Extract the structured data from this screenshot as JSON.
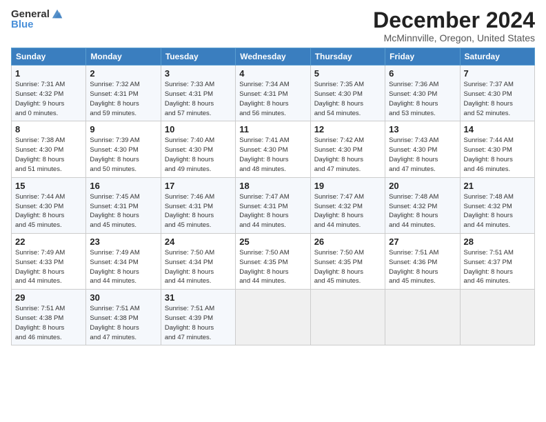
{
  "header": {
    "logo_general": "General",
    "logo_blue": "Blue",
    "title": "December 2024",
    "location": "McMinnville, Oregon, United States"
  },
  "calendar": {
    "days_of_week": [
      "Sunday",
      "Monday",
      "Tuesday",
      "Wednesday",
      "Thursday",
      "Friday",
      "Saturday"
    ],
    "weeks": [
      [
        {
          "day": "1",
          "info": "Sunrise: 7:31 AM\nSunset: 4:32 PM\nDaylight: 9 hours\nand 0 minutes."
        },
        {
          "day": "2",
          "info": "Sunrise: 7:32 AM\nSunset: 4:31 PM\nDaylight: 8 hours\nand 59 minutes."
        },
        {
          "day": "3",
          "info": "Sunrise: 7:33 AM\nSunset: 4:31 PM\nDaylight: 8 hours\nand 57 minutes."
        },
        {
          "day": "4",
          "info": "Sunrise: 7:34 AM\nSunset: 4:31 PM\nDaylight: 8 hours\nand 56 minutes."
        },
        {
          "day": "5",
          "info": "Sunrise: 7:35 AM\nSunset: 4:30 PM\nDaylight: 8 hours\nand 54 minutes."
        },
        {
          "day": "6",
          "info": "Sunrise: 7:36 AM\nSunset: 4:30 PM\nDaylight: 8 hours\nand 53 minutes."
        },
        {
          "day": "7",
          "info": "Sunrise: 7:37 AM\nSunset: 4:30 PM\nDaylight: 8 hours\nand 52 minutes."
        }
      ],
      [
        {
          "day": "8",
          "info": "Sunrise: 7:38 AM\nSunset: 4:30 PM\nDaylight: 8 hours\nand 51 minutes."
        },
        {
          "day": "9",
          "info": "Sunrise: 7:39 AM\nSunset: 4:30 PM\nDaylight: 8 hours\nand 50 minutes."
        },
        {
          "day": "10",
          "info": "Sunrise: 7:40 AM\nSunset: 4:30 PM\nDaylight: 8 hours\nand 49 minutes."
        },
        {
          "day": "11",
          "info": "Sunrise: 7:41 AM\nSunset: 4:30 PM\nDaylight: 8 hours\nand 48 minutes."
        },
        {
          "day": "12",
          "info": "Sunrise: 7:42 AM\nSunset: 4:30 PM\nDaylight: 8 hours\nand 47 minutes."
        },
        {
          "day": "13",
          "info": "Sunrise: 7:43 AM\nSunset: 4:30 PM\nDaylight: 8 hours\nand 47 minutes."
        },
        {
          "day": "14",
          "info": "Sunrise: 7:44 AM\nSunset: 4:30 PM\nDaylight: 8 hours\nand 46 minutes."
        }
      ],
      [
        {
          "day": "15",
          "info": "Sunrise: 7:44 AM\nSunset: 4:30 PM\nDaylight: 8 hours\nand 45 minutes."
        },
        {
          "day": "16",
          "info": "Sunrise: 7:45 AM\nSunset: 4:31 PM\nDaylight: 8 hours\nand 45 minutes."
        },
        {
          "day": "17",
          "info": "Sunrise: 7:46 AM\nSunset: 4:31 PM\nDaylight: 8 hours\nand 45 minutes."
        },
        {
          "day": "18",
          "info": "Sunrise: 7:47 AM\nSunset: 4:31 PM\nDaylight: 8 hours\nand 44 minutes."
        },
        {
          "day": "19",
          "info": "Sunrise: 7:47 AM\nSunset: 4:32 PM\nDaylight: 8 hours\nand 44 minutes."
        },
        {
          "day": "20",
          "info": "Sunrise: 7:48 AM\nSunset: 4:32 PM\nDaylight: 8 hours\nand 44 minutes."
        },
        {
          "day": "21",
          "info": "Sunrise: 7:48 AM\nSunset: 4:32 PM\nDaylight: 8 hours\nand 44 minutes."
        }
      ],
      [
        {
          "day": "22",
          "info": "Sunrise: 7:49 AM\nSunset: 4:33 PM\nDaylight: 8 hours\nand 44 minutes."
        },
        {
          "day": "23",
          "info": "Sunrise: 7:49 AM\nSunset: 4:34 PM\nDaylight: 8 hours\nand 44 minutes."
        },
        {
          "day": "24",
          "info": "Sunrise: 7:50 AM\nSunset: 4:34 PM\nDaylight: 8 hours\nand 44 minutes."
        },
        {
          "day": "25",
          "info": "Sunrise: 7:50 AM\nSunset: 4:35 PM\nDaylight: 8 hours\nand 44 minutes."
        },
        {
          "day": "26",
          "info": "Sunrise: 7:50 AM\nSunset: 4:35 PM\nDaylight: 8 hours\nand 45 minutes."
        },
        {
          "day": "27",
          "info": "Sunrise: 7:51 AM\nSunset: 4:36 PM\nDaylight: 8 hours\nand 45 minutes."
        },
        {
          "day": "28",
          "info": "Sunrise: 7:51 AM\nSunset: 4:37 PM\nDaylight: 8 hours\nand 46 minutes."
        }
      ],
      [
        {
          "day": "29",
          "info": "Sunrise: 7:51 AM\nSunset: 4:38 PM\nDaylight: 8 hours\nand 46 minutes."
        },
        {
          "day": "30",
          "info": "Sunrise: 7:51 AM\nSunset: 4:38 PM\nDaylight: 8 hours\nand 47 minutes."
        },
        {
          "day": "31",
          "info": "Sunrise: 7:51 AM\nSunset: 4:39 PM\nDaylight: 8 hours\nand 47 minutes."
        },
        {
          "day": "",
          "info": ""
        },
        {
          "day": "",
          "info": ""
        },
        {
          "day": "",
          "info": ""
        },
        {
          "day": "",
          "info": ""
        }
      ]
    ]
  }
}
